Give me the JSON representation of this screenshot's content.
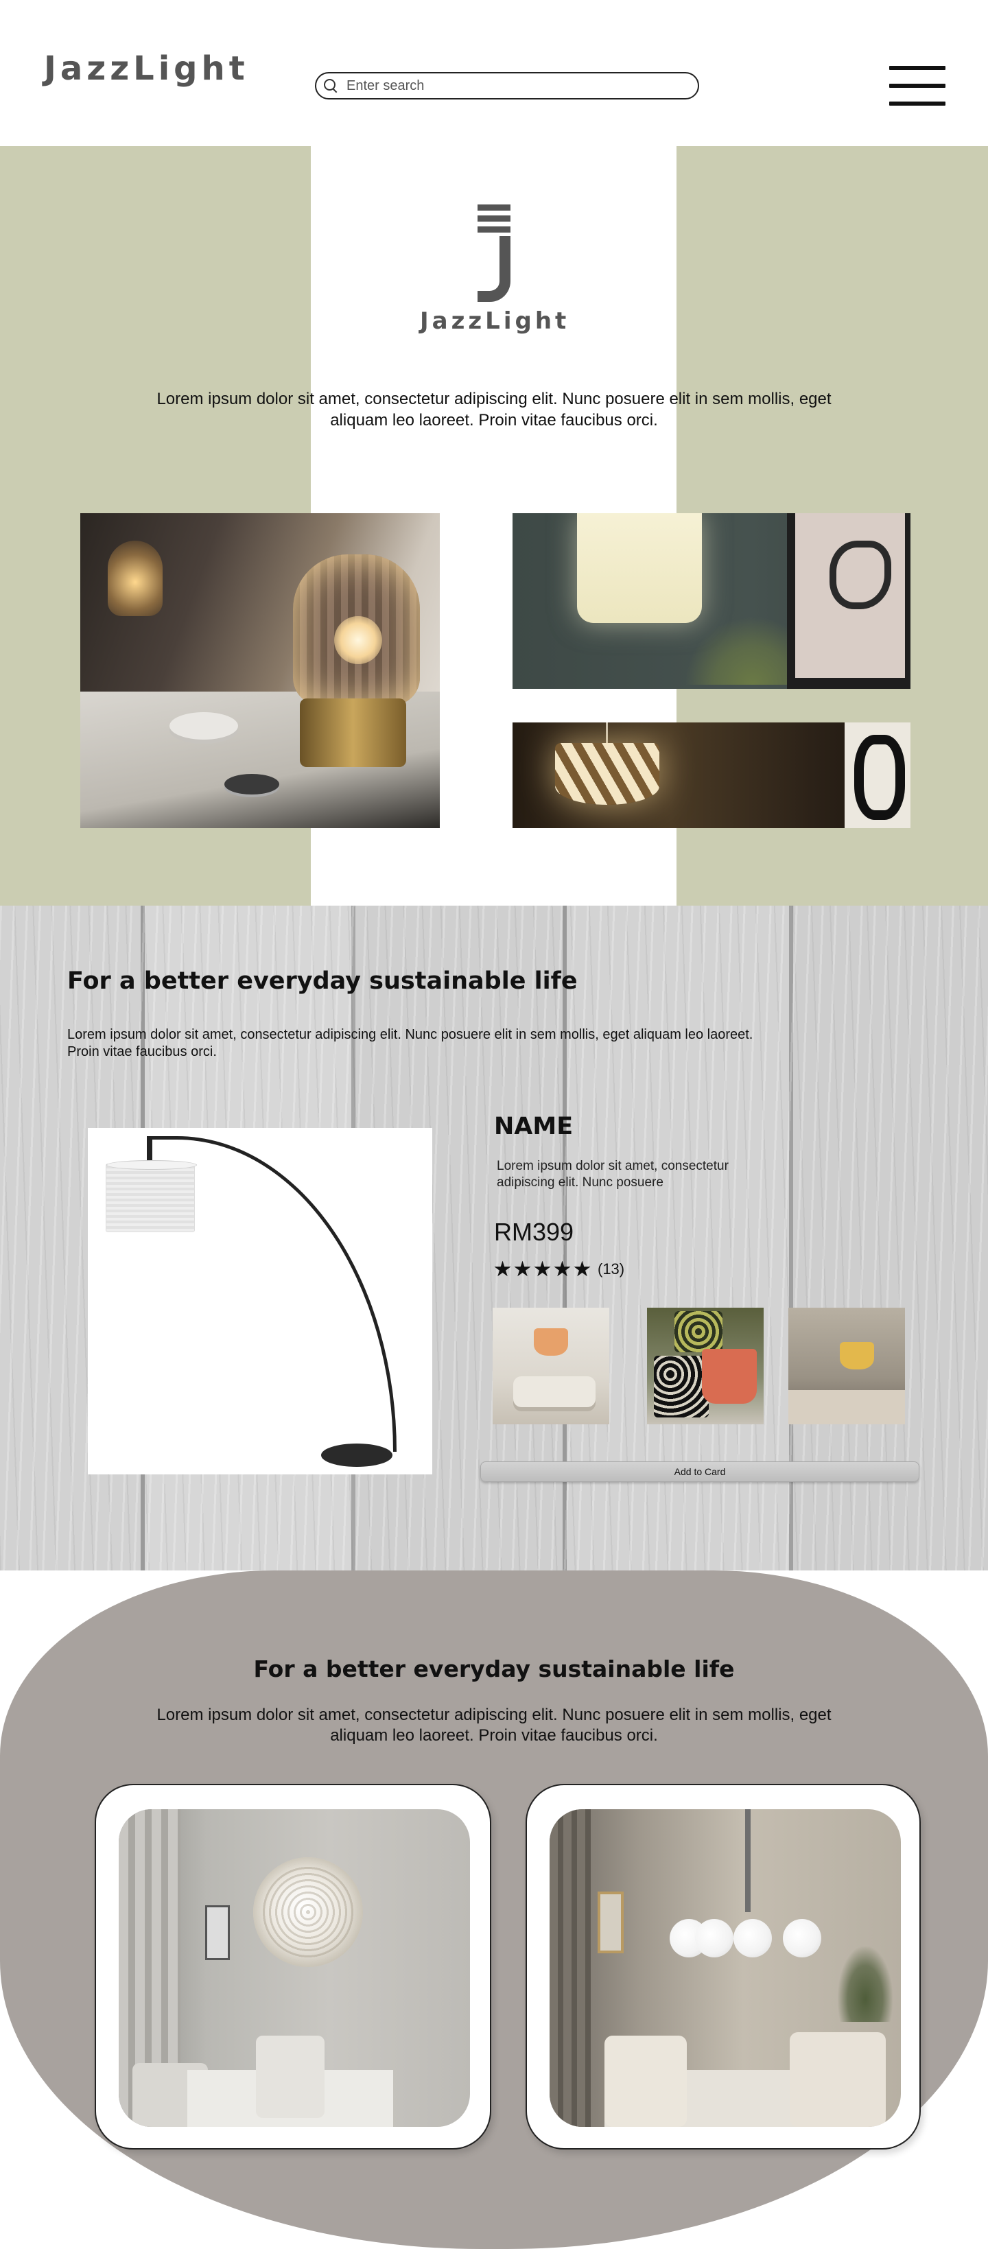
{
  "header": {
    "logo_text": "JazzLight",
    "search_placeholder": "Enter search",
    "menu_label": "menu"
  },
  "hero": {
    "logo_text": "JazzLight",
    "text": "Lorem ipsum dolor sit amet, consectetur adipiscing elit. Nunc posuere elit in sem mollis, eget aliquam leo laoreet. Proin vitae faucibus orci.",
    "colors": {
      "band": "#cbcdb2"
    }
  },
  "product_section": {
    "title": "For a better everyday sustainable life",
    "text": "Lorem ipsum dolor sit amet, consectetur adipiscing elit. Nunc posuere elit in sem mollis, eget aliquam leo laoreet. Proin vitae faucibus orci.",
    "product": {
      "name": "NAME",
      "description": "Lorem ipsum dolor sit amet, consectetur adipiscing elit. Nunc posuere",
      "price": "RM399",
      "rating_stars": 5,
      "rating_count": "(13)",
      "add_to_cart": "Add to Card"
    }
  },
  "bottom_section": {
    "title": "For a better everyday sustainable life",
    "text": "Lorem ipsum dolor sit amet, consectetur adipiscing elit. Nunc posuere elit in sem mollis, eget aliquam leo laoreet. Proin vitae faucibus orci.",
    "colors": {
      "background": "#a8a29e"
    }
  }
}
